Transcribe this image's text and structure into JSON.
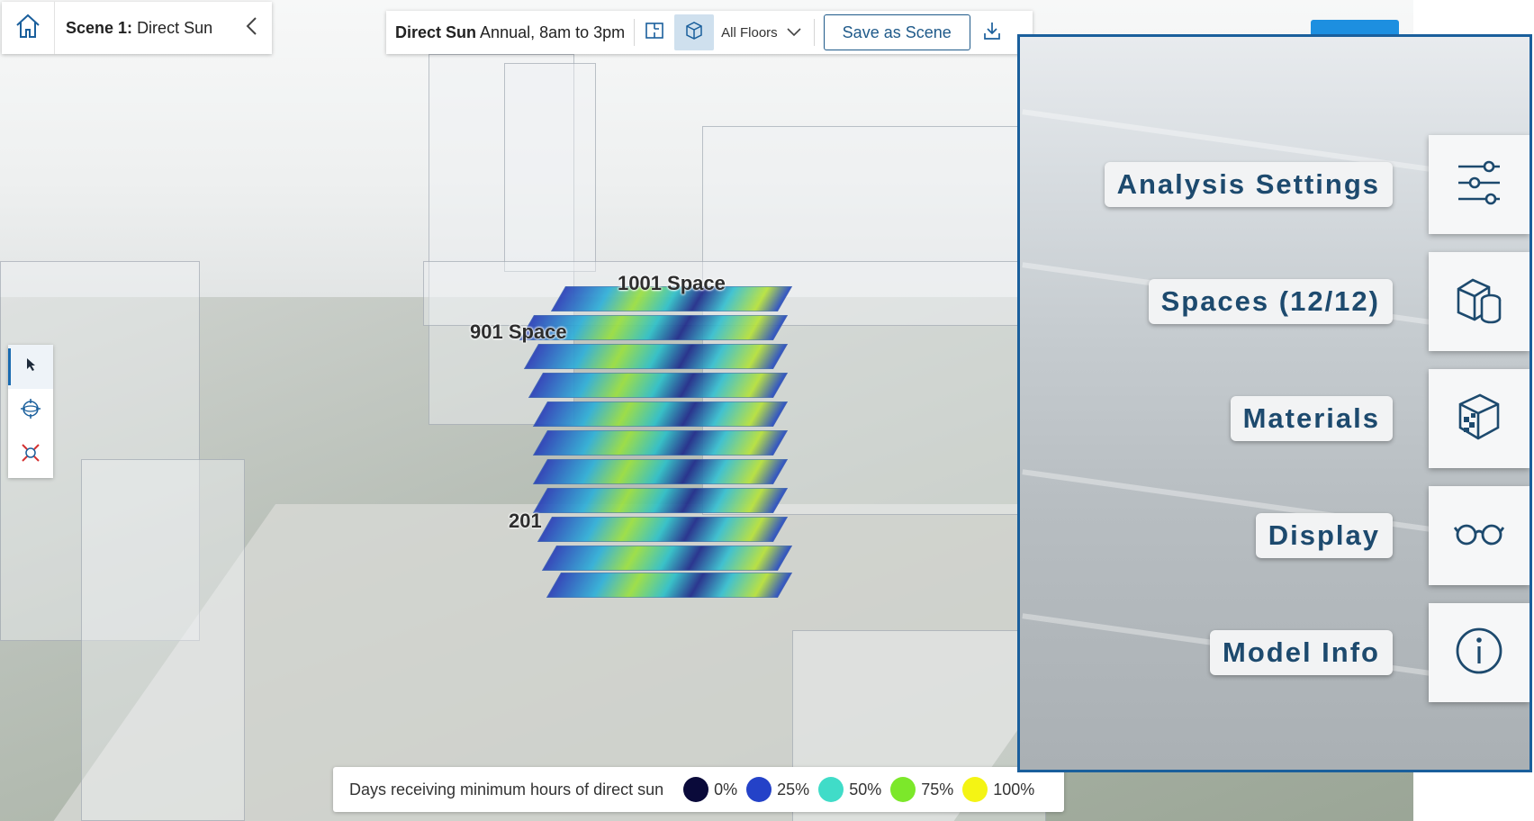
{
  "header": {
    "scene_prefix": "Scene 1:",
    "scene_name": "Direct Sun"
  },
  "toolbar": {
    "analysis_name": "Direct Sun",
    "analysis_period": "Annual, 8am to 3pm",
    "floors_select": "All Floors",
    "save_label": "Save as Scene"
  },
  "viewport": {
    "labels": [
      "1001 Space",
      "901 Space",
      "201"
    ]
  },
  "legend": {
    "description": "Days receiving minimum hours of direct sun",
    "stops": [
      {
        "label": "0%",
        "color": "#0a0a3a"
      },
      {
        "label": "25%",
        "color": "#2442c8"
      },
      {
        "label": "50%",
        "color": "#40dcc8"
      },
      {
        "label": "75%",
        "color": "#7ce82a"
      },
      {
        "label": "100%",
        "color": "#f4f414"
      }
    ]
  },
  "side_menu": {
    "items": [
      {
        "label": "Analysis Settings",
        "icon": "sliders-icon"
      },
      {
        "label": "Spaces (12/12)",
        "icon": "spaces-icon"
      },
      {
        "label": "Materials",
        "icon": "materials-cube-icon"
      },
      {
        "label": "Display",
        "icon": "glasses-icon"
      },
      {
        "label": "Model Info",
        "icon": "info-icon"
      }
    ]
  },
  "colors": {
    "accent": "#1a5f9c",
    "button_text": "#1f5a8a"
  }
}
